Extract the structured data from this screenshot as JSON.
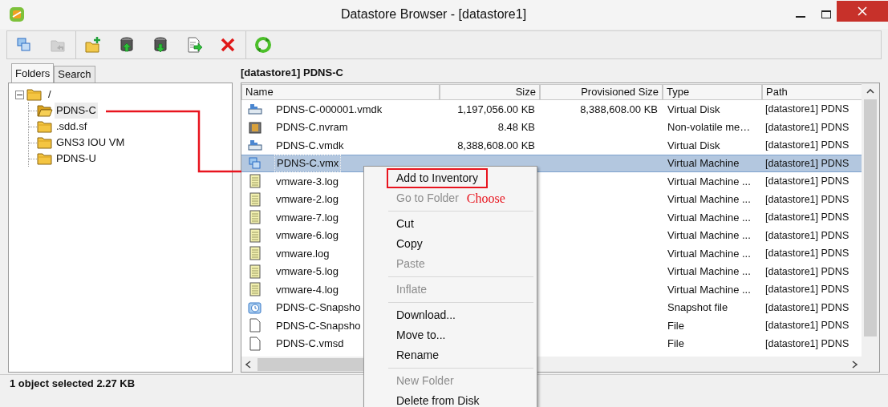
{
  "window": {
    "title": "Datastore Browser - [datastore1]"
  },
  "toolbar": [
    {
      "kind": "inventory",
      "disabled": false
    },
    {
      "kind": "back",
      "disabled": true
    },
    {
      "kind": "new-folder",
      "disabled": false
    },
    {
      "kind": "upload",
      "disabled": false
    },
    {
      "kind": "download",
      "disabled": false
    },
    {
      "kind": "move",
      "disabled": false
    },
    {
      "kind": "delete",
      "disabled": false
    },
    {
      "kind": "refresh",
      "disabled": false
    }
  ],
  "tabs": [
    {
      "label": "Folders",
      "selected": true
    },
    {
      "label": "Search",
      "selected": false
    }
  ],
  "tree": {
    "label": "/",
    "expanded": true,
    "children": [
      {
        "label": "PDNS-C",
        "selected": true
      },
      {
        "label": ".sdd.sf",
        "selected": false
      },
      {
        "label": "GNS3 IOU VM",
        "selected": false
      },
      {
        "label": "PDNS-U",
        "selected": false
      }
    ]
  },
  "panel_title": "[datastore1] PDNS-C",
  "table": {
    "columns": [
      "Name",
      "Size",
      "Provisioned Size",
      "Type",
      "Path"
    ],
    "rows": [
      {
        "kind": "disk",
        "name": "PDNS-C-000001.vmdk",
        "size": "1,197,056.00 KB",
        "provisioned_size": "8,388,608.00 KB",
        "type": "Virtual Disk",
        "path": "[datastore1] PDNS",
        "selected": false
      },
      {
        "kind": "nvram",
        "name": "PDNS-C.nvram",
        "size": "8.48 KB",
        "type": "Non-volatile me…",
        "path": "[datastore1] PDNS",
        "selected": false
      },
      {
        "kind": "disk",
        "name": "PDNS-C.vmdk",
        "size": "8,388,608.00 KB",
        "type": "Virtual Disk",
        "path": "[datastore1] PDNS",
        "selected": false
      },
      {
        "kind": "vm",
        "name": "PDNS-C.vmx",
        "type": "Virtual Machine",
        "path": "[datastore1] PDNS",
        "selected": true
      },
      {
        "kind": "log",
        "name": "vmware-3.log",
        "type": "Virtual Machine ...",
        "path": "[datastore1] PDNS",
        "selected": false
      },
      {
        "kind": "log",
        "name": "vmware-2.log",
        "type": "Virtual Machine ...",
        "path": "[datastore1] PDNS",
        "selected": false
      },
      {
        "kind": "log",
        "name": "vmware-7.log",
        "type": "Virtual Machine ...",
        "path": "[datastore1] PDNS",
        "selected": false
      },
      {
        "kind": "log",
        "name": "vmware-6.log",
        "type": "Virtual Machine ...",
        "path": "[datastore1] PDNS",
        "selected": false
      },
      {
        "kind": "log",
        "name": "vmware.log",
        "type": "Virtual Machine ...",
        "path": "[datastore1] PDNS",
        "selected": false
      },
      {
        "kind": "log",
        "name": "vmware-5.log",
        "type": "Virtual Machine ...",
        "path": "[datastore1] PDNS",
        "selected": false
      },
      {
        "kind": "log",
        "name": "vmware-4.log",
        "type": "Virtual Machine ...",
        "path": "[datastore1] PDNS",
        "selected": false
      },
      {
        "kind": "snapshot",
        "name": "PDNS-C-Snapsho",
        "type": "Snapshot file",
        "path": "[datastore1] PDNS",
        "selected": false
      },
      {
        "kind": "file",
        "name": "PDNS-C-Snapsho",
        "type": "File",
        "path": "[datastore1] PDNS",
        "selected": false
      },
      {
        "kind": "file",
        "name": "PDNS-C.vmsd",
        "type": "File",
        "path": "[datastore1] PDNS",
        "selected": false
      }
    ]
  },
  "context_menu": {
    "items": [
      {
        "kind": "item",
        "label": "Add to Inventory",
        "disabled": false,
        "boxed": true
      },
      {
        "kind": "item",
        "label": "Go to Folder",
        "disabled": true,
        "boxed": false,
        "note": "Choose"
      },
      {
        "kind": "separator"
      },
      {
        "kind": "item",
        "label": "Cut",
        "disabled": false,
        "boxed": false
      },
      {
        "kind": "item",
        "label": "Copy",
        "disabled": false,
        "boxed": false
      },
      {
        "kind": "item",
        "label": "Paste",
        "disabled": true,
        "boxed": false
      },
      {
        "kind": "separator"
      },
      {
        "kind": "item",
        "label": "Inflate",
        "disabled": true,
        "boxed": false
      },
      {
        "kind": "separator"
      },
      {
        "kind": "item",
        "label": "Download...",
        "disabled": false,
        "boxed": false
      },
      {
        "kind": "item",
        "label": "Move to...",
        "disabled": false,
        "boxed": false
      },
      {
        "kind": "item",
        "label": "Rename",
        "disabled": false,
        "boxed": false
      },
      {
        "kind": "separator"
      },
      {
        "kind": "item",
        "label": "New Folder",
        "disabled": true,
        "boxed": false
      },
      {
        "kind": "item",
        "label": "Delete from Disk",
        "disabled": false,
        "boxed": false
      }
    ]
  },
  "status_bar": "1 object selected 2.27 KB"
}
